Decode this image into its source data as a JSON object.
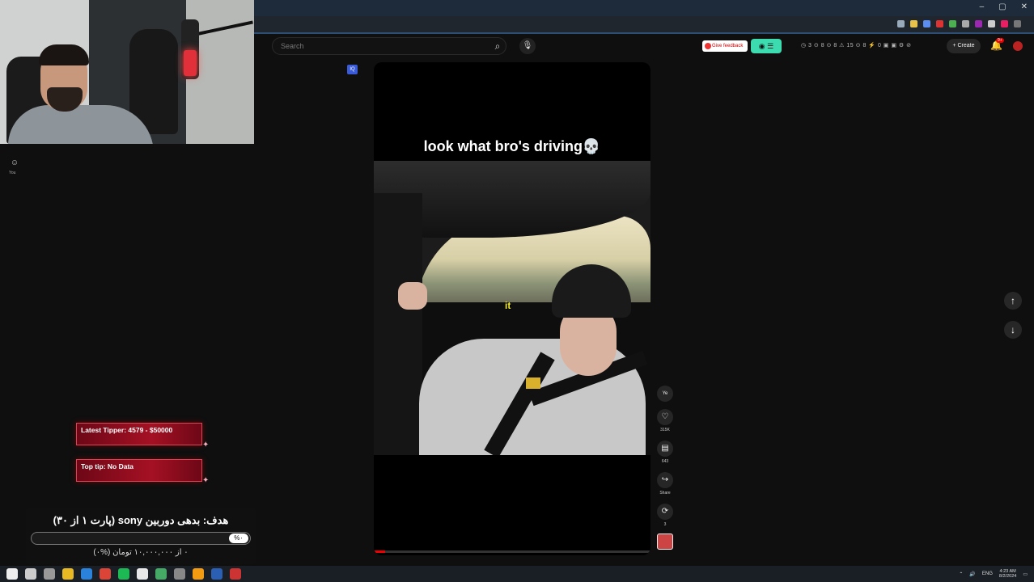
{
  "browser": {
    "window_controls": [
      "–",
      "▢",
      "✕"
    ],
    "extension_colors": [
      "#9ab",
      "#e8c14a",
      "#5b8ef0",
      "#d33",
      "#4caf50",
      "#aaa",
      "#9c27b0",
      "#ccc",
      "#e91e63",
      "#777"
    ]
  },
  "header": {
    "search_placeholder": "Search",
    "search_icon": "search-icon",
    "mic_icon": "mic-icon",
    "feedback_label": "Give feedback",
    "stats_text": "◷ 3  ⊙ 8  ⊙ 8  ⚠ 15  ⊙ 8  ⚡ 0  ▣ ▣  ⚙ ⊘",
    "create_label": "+ Create",
    "notification_badge": "9+"
  },
  "sidebar": {
    "you_label": "You"
  },
  "overlays": {
    "latest_tipper": "Latest Tipper: 4579 - $50000",
    "top_tip": "Top tip: No Data",
    "goal_title": "هدف: بدهی دوربین sony (پارت ۱ از ۳۰)",
    "goal_percent": "%۰",
    "goal_percent_value": 0,
    "goal_subtitle": "۰ از ۱۰,۰۰۰,۰۰۰ تومان (%۰)"
  },
  "short": {
    "channel_badge": "IQ",
    "caption": "look what bro's driving💀",
    "subtitle_word": "it",
    "progress": 0.04,
    "actions": [
      {
        "name": "avatar",
        "icon": "Ye",
        "label": ""
      },
      {
        "name": "like",
        "icon": "♡",
        "label": "315K"
      },
      {
        "name": "comments",
        "icon": "▤",
        "label": "643"
      },
      {
        "name": "share",
        "icon": "↪",
        "label": "Share"
      },
      {
        "name": "remix",
        "icon": "⟳",
        "label": "3"
      }
    ]
  },
  "navigation": {
    "up_icon": "↑",
    "down_icon": "↓"
  },
  "taskbar": {
    "icon_colors": [
      "#eee",
      "#ccc",
      "#999",
      "#e8b923",
      "#2a82da",
      "#db4437",
      "#1db954",
      "#e8e8e8",
      "#4a6",
      "#888",
      "#f39c12",
      "#2b5fb3",
      "#c33"
    ],
    "language": "ENG",
    "time": "4:23 AM",
    "date": "8/2/2024"
  }
}
